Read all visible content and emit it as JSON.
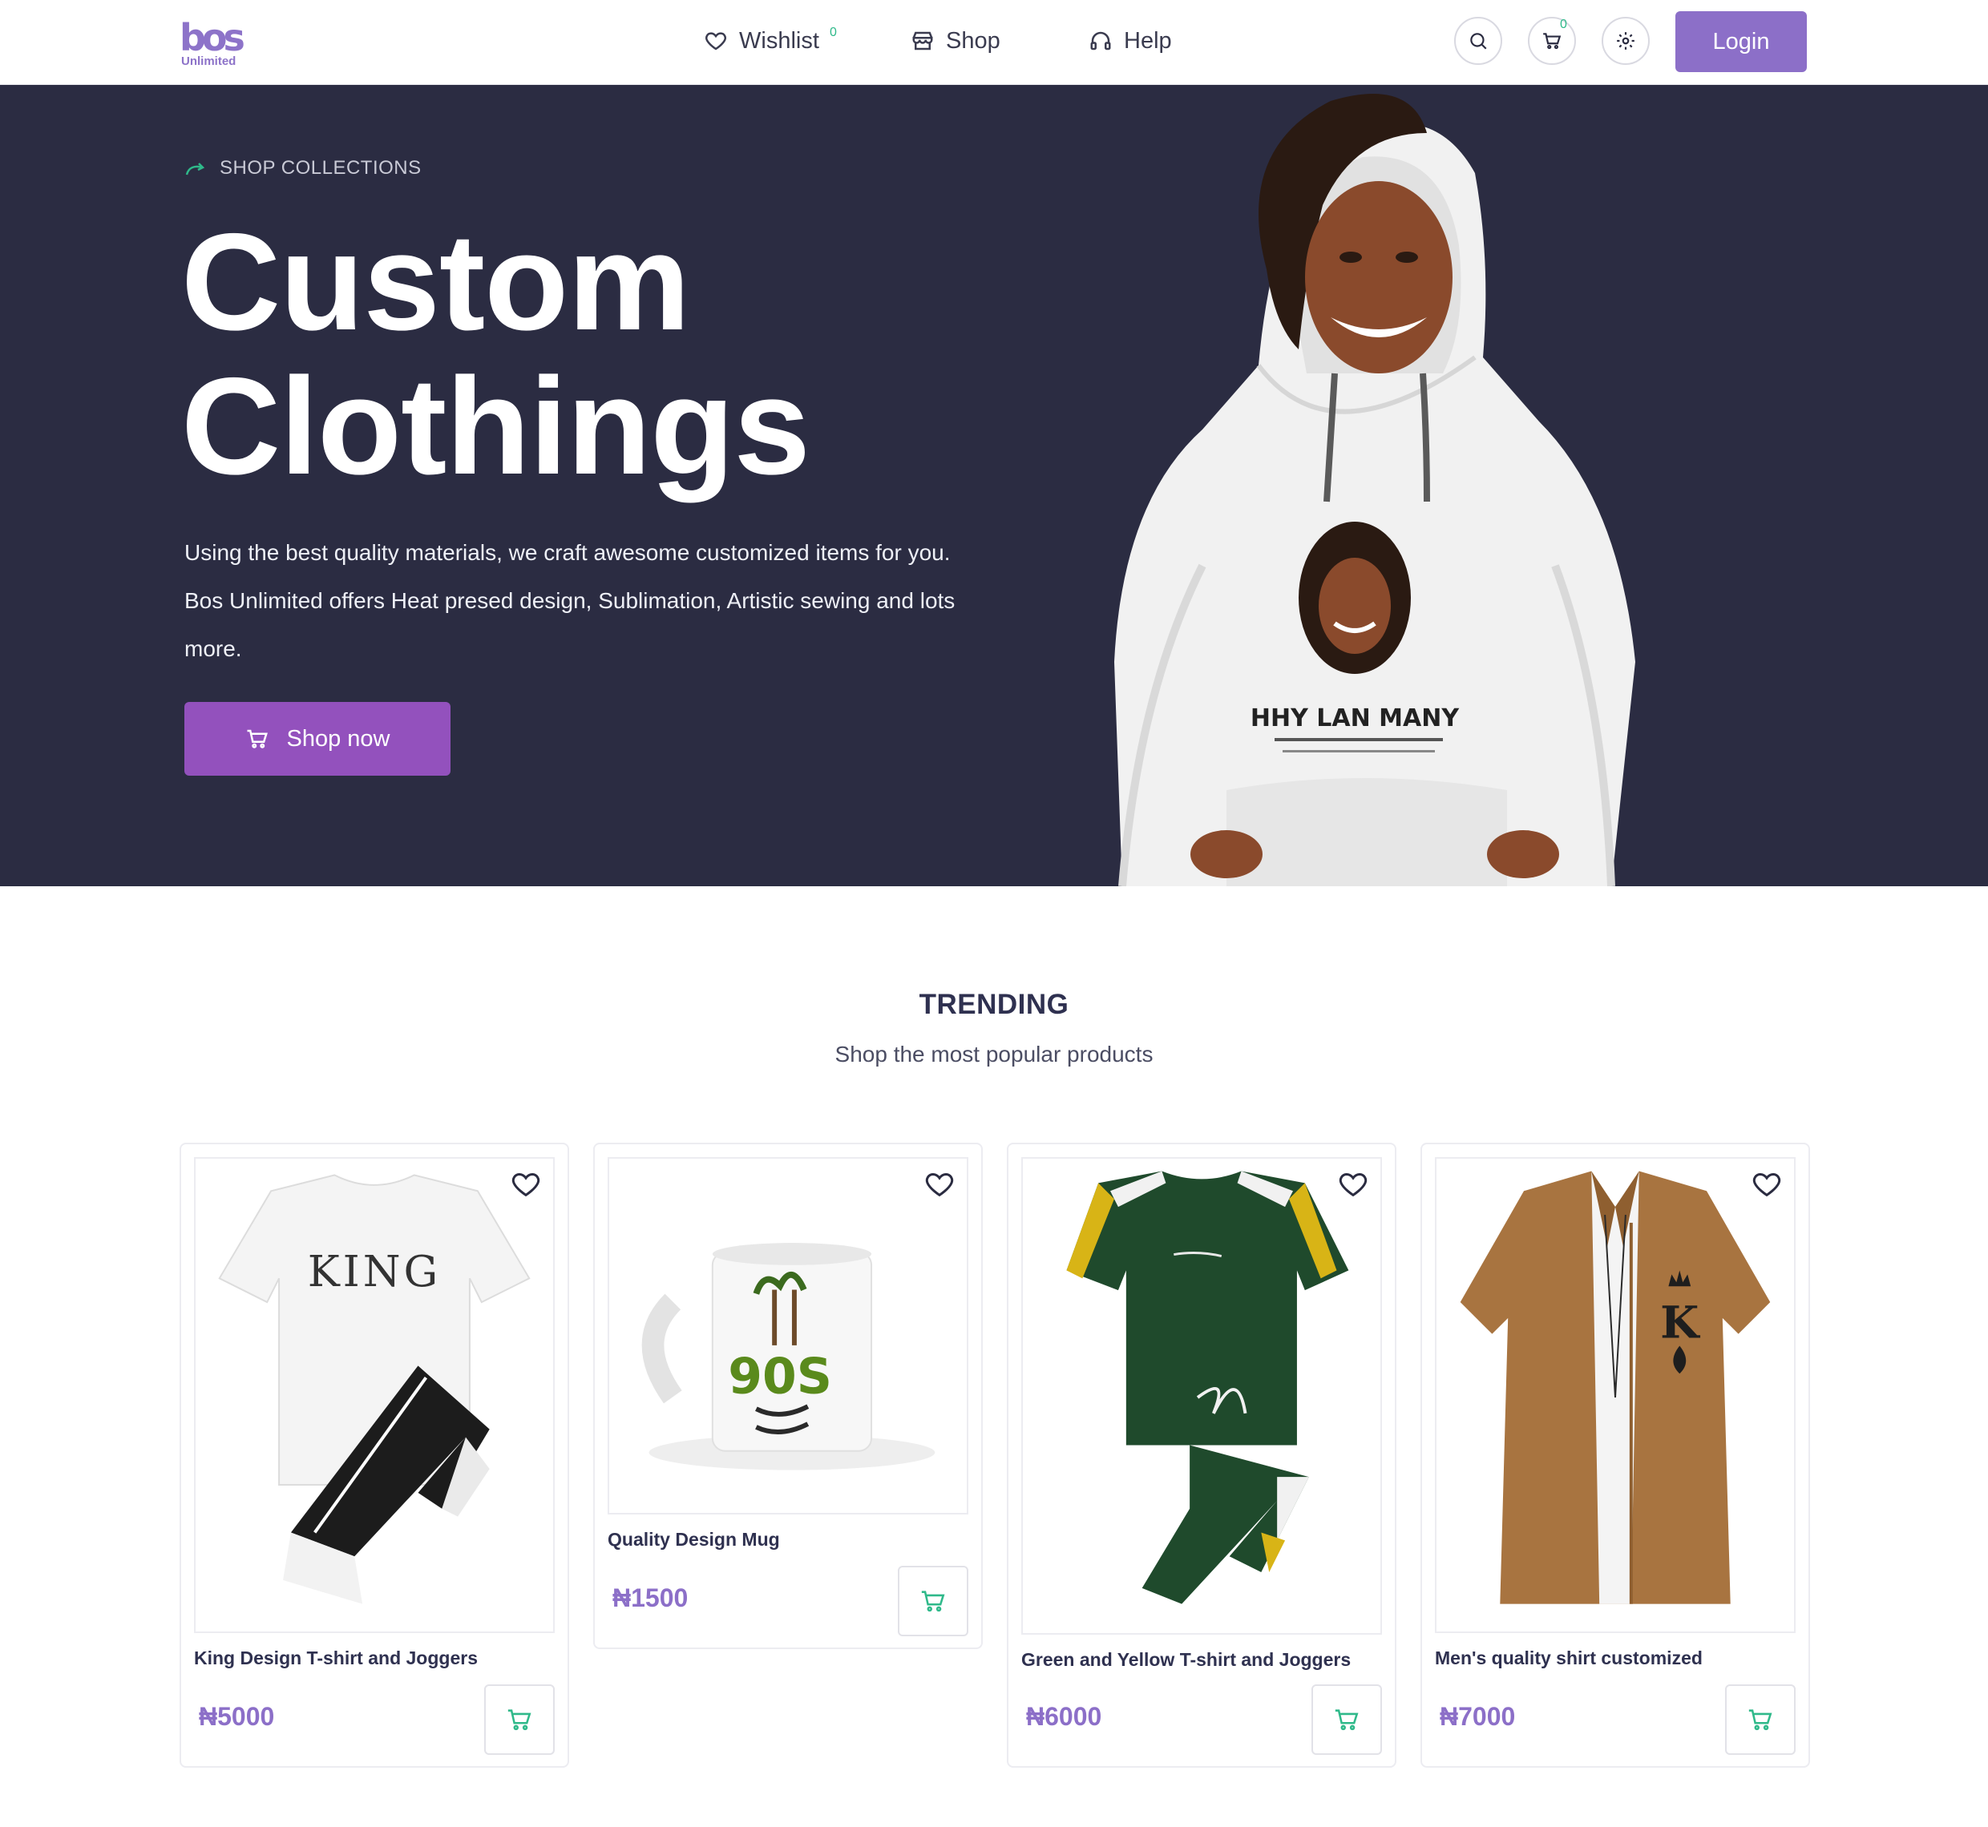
{
  "header": {
    "logo_mark": "bos",
    "logo_sub": "Unlimited",
    "nav": [
      {
        "label": "Wishlist",
        "badge": "0"
      },
      {
        "label": "Shop"
      },
      {
        "label": "Help"
      }
    ],
    "cart_badge": "0",
    "login_label": "Login"
  },
  "hero": {
    "eyebrow": "SHOP COLLECTIONS",
    "title_line1": "Custom",
    "title_line2": "Clothings",
    "description": "Using the best quality materials, we craft awesome customized items for you. Bos Unlimited offers Heat presed design, Sublimation, Artistic sewing and lots more.",
    "cta_label": "Shop now",
    "hoodie_print": "HHY LAN MANY"
  },
  "trending": {
    "title": "TRENDING",
    "subtitle": "Shop the most popular products",
    "products": [
      {
        "name": "King Design T-shirt and Joggers",
        "currency": "₦",
        "price": "5000",
        "print": "KING"
      },
      {
        "name": "Quality Design Mug",
        "currency": "₦",
        "price": "1500",
        "print": "90S"
      },
      {
        "name": "Green and Yellow T-shirt and Joggers",
        "currency": "₦",
        "price": "6000"
      },
      {
        "name": "Men's quality shirt customized",
        "currency": "₦",
        "price": "7000",
        "print": "K"
      }
    ]
  },
  "colors": {
    "accent": "#8c6fc8",
    "cta": "#9351bd",
    "hero_bg": "#2b2c42",
    "cart_icon": "#2fb98a"
  }
}
